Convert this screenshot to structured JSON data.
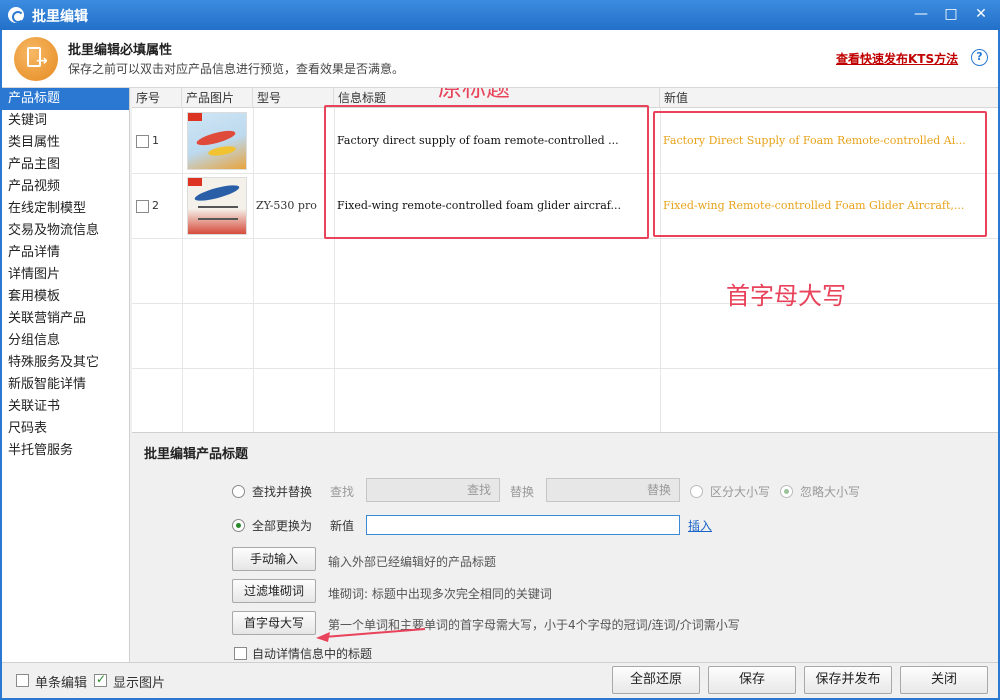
{
  "window": {
    "title": "批里编辑",
    "minimize_glyph": "—",
    "maximize_glyph": "□",
    "close_glyph": "✕"
  },
  "header": {
    "title": "批里编辑必填属性",
    "subtitle": "保存之前可以双击对应产品信息进行预览，查看效果是否满意。",
    "link": "查看快速发布KTS方法",
    "help_icon": "?"
  },
  "sidebar": {
    "items": [
      {
        "label": "产品标题",
        "active": true
      },
      {
        "label": "关键词"
      },
      {
        "label": "类目属性"
      },
      {
        "label": "产品主图"
      },
      {
        "label": "产品视频"
      },
      {
        "label": "在线定制模型"
      },
      {
        "label": "交易及物流信息"
      },
      {
        "label": "产品详情"
      },
      {
        "label": "详情图片"
      },
      {
        "label": "套用模板"
      },
      {
        "label": "关联营销产品"
      },
      {
        "label": "分组信息"
      },
      {
        "label": "特殊服务及其它"
      },
      {
        "label": "新版智能详情"
      },
      {
        "label": "关联证书"
      },
      {
        "label": "尺码表"
      },
      {
        "label": "半托管服务"
      }
    ]
  },
  "table": {
    "columns": [
      "序号",
      "产品图片",
      "型号",
      "信息标题",
      "新值"
    ],
    "rows": [
      {
        "index": "1",
        "model": "",
        "title": "Factory direct supply of foam remote-controlled ...",
        "new_value": "Factory Direct Supply of Foam Remote-controlled Ai..."
      },
      {
        "index": "2",
        "model": "ZY-530 pro",
        "title": "Fixed-wing remote-controlled foam glider aircraf...",
        "new_value": "Fixed-wing Remote-controlled Foam Glider Aircraft,..."
      }
    ],
    "new_value_color": "#e8a31c"
  },
  "annotations": {
    "original_title": "原标题",
    "capitalize": "首字母大写",
    "color": "#e8435a"
  },
  "panel": {
    "title": "批里编辑产品标题",
    "find_replace_label": "查找并替换",
    "find_label": "查找",
    "find_button": "查找",
    "replace_label": "替换",
    "replace_button": "替换",
    "case_sensitive": "区分大小写",
    "ignore_case": "忽略大小写",
    "replace_all_label": "全部更换为",
    "new_value_label": "新值",
    "new_value_input": "",
    "insert_link": "插入",
    "manual_button": "手动输入",
    "manual_desc": "输入外部已经编辑好的产品标题",
    "filter_button": "过滤堆砌词",
    "filter_desc": "堆砌词: 标题中出现多次完全相同的关键词",
    "capitalize_button": "首字母大写",
    "capitalize_desc": "第一个单词和主要单词的首字母需大写，小于4个字母的冠词/连词/介词需小写",
    "auto_detail": "自动详情信息中的标题"
  },
  "footer": {
    "single_edit": "单条编辑",
    "show_images": "显示图片",
    "restore_all": "全部还原",
    "save": "保存",
    "save_publish": "保存并发布",
    "close": "关闭"
  }
}
